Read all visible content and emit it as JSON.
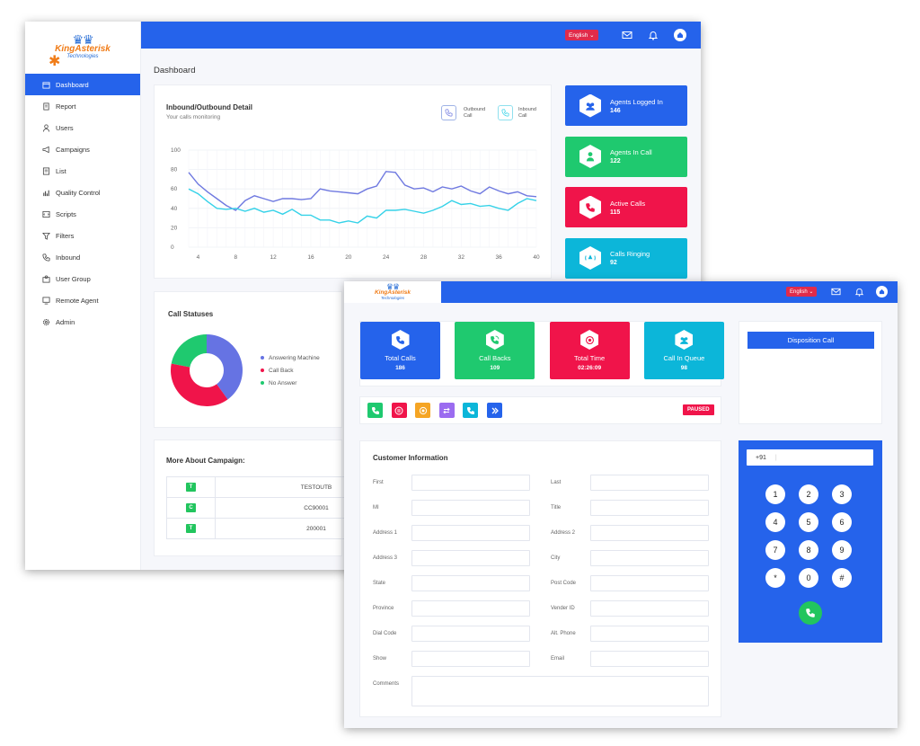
{
  "app": {
    "logo_line1": "KingAsterisk",
    "logo_line2": "Technologies",
    "language": "English"
  },
  "sidebar": {
    "items": [
      {
        "label": "Dashboard",
        "icon": "calendar-icon"
      },
      {
        "label": "Report",
        "icon": "document-icon"
      },
      {
        "label": "Users",
        "icon": "user-icon"
      },
      {
        "label": "Campaigns",
        "icon": "megaphone-icon"
      },
      {
        "label": "List",
        "icon": "list-icon"
      },
      {
        "label": "Quality Control",
        "icon": "bar-chart-icon"
      },
      {
        "label": "Scripts",
        "icon": "script-icon"
      },
      {
        "label": "Filters",
        "icon": "filter-icon"
      },
      {
        "label": "Inbound",
        "icon": "phone-icon"
      },
      {
        "label": "User Group",
        "icon": "group-icon"
      },
      {
        "label": "Remote Agent",
        "icon": "remote-icon"
      },
      {
        "label": "Admin",
        "icon": "gear-icon"
      }
    ]
  },
  "dashboard": {
    "title": "Dashboard",
    "chart_title": "Inbound/Outbound Detail",
    "chart_subtitle": "Your calls monitoring",
    "legend_outbound": "Outbound Call",
    "legend_inbound": "Inbound Call",
    "stats": [
      {
        "label": "Agents Logged In",
        "value": "146",
        "color": "#2563eb",
        "icon": "users-icon"
      },
      {
        "label": "Agents In Call",
        "value": "122",
        "color": "#1fc96f",
        "icon": "agent-icon"
      },
      {
        "label": "Active Calls",
        "value": "115",
        "color": "#f0144a",
        "icon": "phone-icon"
      },
      {
        "label": "Calls Ringing",
        "value": "92",
        "color": "#0cb6d9",
        "icon": "ringing-icon"
      }
    ],
    "statuses_title": "Call Statuses",
    "campaign_title": "More About Campaign:",
    "campaign_rows": [
      {
        "badge": "T",
        "name": "TESTOUTB"
      },
      {
        "badge": "C",
        "name": "CC90001"
      },
      {
        "badge": "T",
        "name": "200001"
      }
    ]
  },
  "chart_data": [
    {
      "type": "line",
      "x": [
        3,
        4,
        5,
        6,
        7,
        8,
        9,
        10,
        11,
        12,
        13,
        14,
        15,
        16,
        17,
        18,
        19,
        20,
        21,
        22,
        23,
        24,
        25,
        26,
        27,
        28,
        29,
        30,
        31,
        32,
        33,
        34,
        35,
        36,
        37,
        38,
        39,
        40
      ],
      "ylim": [
        0,
        100
      ],
      "xticks": [
        4,
        8,
        12,
        16,
        20,
        24,
        28,
        32,
        36,
        40
      ],
      "yticks": [
        0,
        20,
        40,
        60,
        80,
        100
      ],
      "grid": true,
      "series": [
        {
          "values": [
            77,
            65,
            57,
            50,
            43,
            38,
            48,
            53,
            50,
            47,
            50,
            50,
            49,
            50,
            60,
            58,
            57,
            56,
            55,
            60,
            63,
            78,
            77,
            64,
            60,
            61,
            57,
            62,
            60,
            63,
            58,
            55,
            62,
            58,
            55,
            57,
            53,
            52
          ],
          "color": "#6f79e0"
        },
        {
          "values": [
            60,
            55,
            47,
            40,
            39,
            40,
            37,
            40,
            36,
            38,
            34,
            39,
            33,
            33,
            28,
            28,
            25,
            27,
            25,
            32,
            30,
            38,
            38,
            39,
            37,
            35,
            38,
            42,
            48,
            44,
            45,
            42,
            43,
            40,
            38,
            45,
            50,
            48
          ],
          "color": "#36d2e8"
        }
      ]
    },
    {
      "type": "pie",
      "labels": [
        "Answering Machine",
        "Call Back",
        "No Answer"
      ],
      "values": [
        40,
        38,
        22
      ],
      "colors": [
        "#6673e3",
        "#f0144a",
        "#1fc96f"
      ],
      "legend": "right"
    }
  ],
  "agent": {
    "tiles": [
      {
        "label": "Total Calls",
        "value": "186",
        "color": "#2563eb",
        "icon": "phone-icon"
      },
      {
        "label": "Call Backs",
        "value": "109",
        "color": "#1fc96f",
        "icon": "callback-icon"
      },
      {
        "label": "Total Time",
        "value": "02:26:09",
        "color": "#f0144a",
        "icon": "timer-icon"
      },
      {
        "label": "Call In Queue",
        "value": "98",
        "color": "#0cb6d9",
        "icon": "queue-icon"
      }
    ],
    "disposition": "Disposition Call",
    "actions": [
      {
        "name": "answer-call-button",
        "color": "#1fc96f",
        "icon": "phone-icon"
      },
      {
        "name": "pause-button",
        "color": "#f0144a",
        "icon": "pause-icon"
      },
      {
        "name": "record-button",
        "color": "#f5a524",
        "icon": "record-icon"
      },
      {
        "name": "transfer-button",
        "color": "#9b6cf0",
        "icon": "transfer-icon"
      },
      {
        "name": "dial-button",
        "color": "#0cb6d9",
        "icon": "phone-icon"
      },
      {
        "name": "next-button",
        "color": "#2563eb",
        "icon": "forward-icon"
      }
    ],
    "status": "PAUSED",
    "form_title": "Customer Information",
    "fields": {
      "left": [
        "First",
        "MI",
        "Address 1",
        "Address 3",
        "State",
        "Province",
        "Dial Code",
        "Show"
      ],
      "right": [
        "Last",
        "Title",
        "Address 2",
        "City",
        "Post Code",
        "Vender ID",
        "Alt. Phone",
        "Email"
      ],
      "comments": "Comments"
    },
    "dialer": {
      "prefix": "+91",
      "keys": [
        "1",
        "2",
        "3",
        "4",
        "5",
        "6",
        "7",
        "8",
        "9",
        "*",
        "0",
        "#"
      ]
    }
  }
}
